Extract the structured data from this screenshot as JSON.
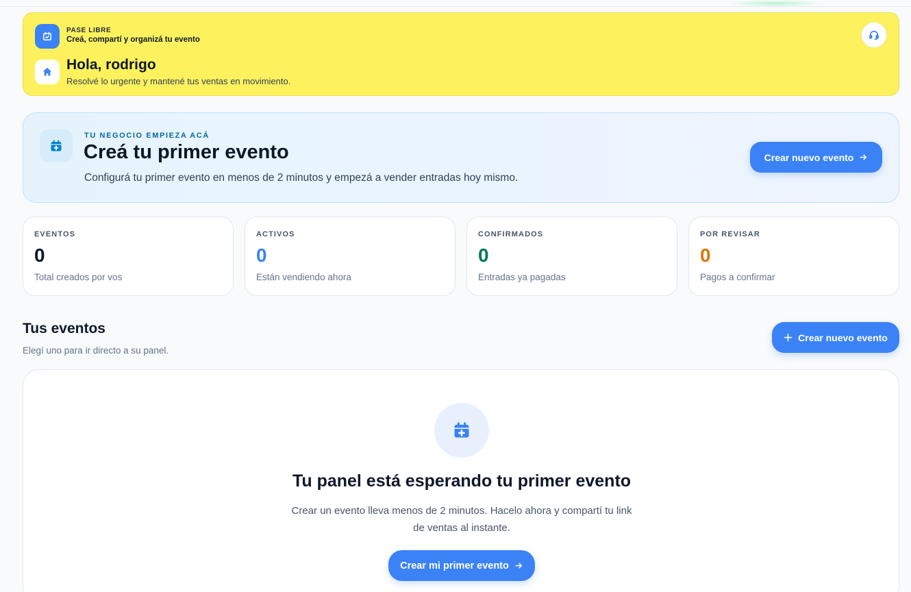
{
  "header": {
    "kicker": "PASE LIBRE",
    "tagline": "Creá, compartí y organizá tu evento",
    "greeting": "Hola, rodrigo",
    "greeting_sub": "Resolvé lo urgente y mantené tus ventas en movimiento.",
    "icons": {
      "brand": "calendar-check-icon",
      "home": "home-icon",
      "support": "headset-icon"
    }
  },
  "hero": {
    "kicker": "TU NEGOCIO EMPIEZA ACÁ",
    "title": "Creá tu primer evento",
    "subtitle": "Configurá tu primer evento en menos de 2 minutos y empezá a vender entradas hoy mismo.",
    "button_label": "Crear nuevo evento",
    "icon": "calendar-plus-icon"
  },
  "stats": [
    {
      "label": "EVENTOS",
      "value": "0",
      "caption": "Total creados por vos",
      "color": "#0f172a"
    },
    {
      "label": "ACTIVOS",
      "value": "0",
      "caption": "Están vendiendo ahora",
      "color": "#3b82f6"
    },
    {
      "label": "CONFIRMADOS",
      "value": "0",
      "caption": "Entradas ya pagadas",
      "color": "#047857"
    },
    {
      "label": "POR REVISAR",
      "value": "0",
      "caption": "Pagos a confirmar",
      "color": "#d97706"
    }
  ],
  "events": {
    "title": "Tus eventos",
    "subtitle": "Elegí uno para ir directo a su panel.",
    "button_label": "Crear nuevo evento",
    "empty": {
      "title": "Tu panel está esperando tu primer evento",
      "description": "Crear un evento lleva menos de 2 minutos. Hacelo ahora y compartí tu link de ventas al instante.",
      "button_label": "Crear mi primer evento",
      "icon": "calendar-plus-icon"
    }
  },
  "colors": {
    "accent": "#3b82f6",
    "banner": "#fdf25e"
  }
}
